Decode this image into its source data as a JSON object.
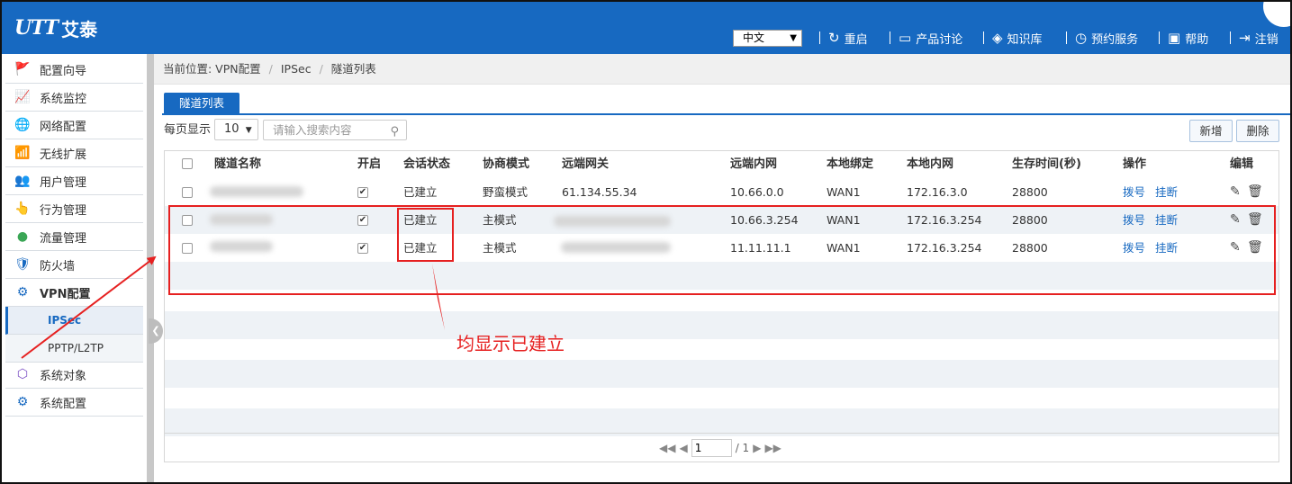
{
  "brand": {
    "mark": "UTT",
    "name": "艾泰"
  },
  "header": {
    "language": "中文",
    "nav": [
      {
        "label": "重启",
        "icon": "restart-icon",
        "glyph": "↻"
      },
      {
        "label": "产品讨论",
        "icon": "chat-icon",
        "glyph": "▭"
      },
      {
        "label": "知识库",
        "icon": "layers-icon",
        "glyph": "◈"
      },
      {
        "label": "预约服务",
        "icon": "clock-icon",
        "glyph": "◷"
      },
      {
        "label": "帮助",
        "icon": "book-icon",
        "glyph": "▣"
      },
      {
        "label": "注销",
        "icon": "logout-icon",
        "glyph": "⇥"
      }
    ]
  },
  "sidebar": {
    "items": [
      {
        "label": "配置向导",
        "icon": "wizard-icon",
        "glyph": "🚩"
      },
      {
        "label": "系统监控",
        "icon": "monitor-icon",
        "glyph": "📈"
      },
      {
        "label": "网络配置",
        "icon": "globe-icon",
        "glyph": "🌐"
      },
      {
        "label": "无线扩展",
        "icon": "wireless-icon",
        "glyph": "📶"
      },
      {
        "label": "用户管理",
        "icon": "users-icon",
        "glyph": "👥"
      },
      {
        "label": "行为管理",
        "icon": "hand-icon",
        "glyph": "👆"
      },
      {
        "label": "流量管理",
        "icon": "traffic-icon",
        "glyph": "●"
      },
      {
        "label": "防火墙",
        "icon": "shield-icon",
        "glyph": "🛡"
      },
      {
        "label": "VPN配置",
        "icon": "vpn-icon",
        "glyph": "⚙"
      }
    ],
    "sub_items": [
      {
        "label": "IPSec"
      },
      {
        "label": "PPTP/L2TP"
      }
    ],
    "bottom_items": [
      {
        "label": "系统对象",
        "icon": "cube-icon",
        "glyph": "⬡"
      },
      {
        "label": "系统配置",
        "icon": "gear-icon",
        "glyph": "⚙"
      }
    ]
  },
  "breadcrumb": {
    "prefix": "当前位置: VPN配置",
    "parts": [
      "IPSec",
      "隧道列表"
    ]
  },
  "tab": {
    "label": "隧道列表"
  },
  "toolbar": {
    "per_page_label": "每页显示",
    "per_page_value": "10",
    "search_placeholder": "请输入搜索内容",
    "add_label": "新增",
    "delete_label": "删除"
  },
  "table": {
    "headers": [
      "隧道名称",
      "开启",
      "会话状态",
      "协商模式",
      "远端网关",
      "远端内网",
      "本地绑定",
      "本地内网",
      "生存时间(秒)",
      "操作",
      "编辑"
    ],
    "rows": [
      {
        "enabled": "✔",
        "status": "已建立",
        "mode": "野蛮模式",
        "gateway": "61.134.55.34",
        "remote_net": "10.66.0.0",
        "bind": "WAN1",
        "local_net": "172.16.3.0",
        "ttl": "28800",
        "dial": "拨号",
        "hangup": "挂断"
      },
      {
        "enabled": "✔",
        "status": "已建立",
        "mode": "主模式",
        "gateway": "",
        "remote_net": "10.66.3.254",
        "bind": "WAN1",
        "local_net": "172.16.3.254",
        "ttl": "28800",
        "dial": "拨号",
        "hangup": "挂断"
      },
      {
        "enabled": "✔",
        "status": "已建立",
        "mode": "主模式",
        "gateway": "",
        "remote_net": "11.11.11.1",
        "bind": "WAN1",
        "local_net": "172.16.3.254",
        "ttl": "28800",
        "dial": "拨号",
        "hangup": "挂断"
      }
    ]
  },
  "pager": {
    "current": "1",
    "total": "/ 1"
  },
  "annotation": {
    "text": "均显示已建立",
    "color": "#e62020"
  },
  "colors": {
    "brand": "#1769c1",
    "annotation": "#e62020"
  }
}
